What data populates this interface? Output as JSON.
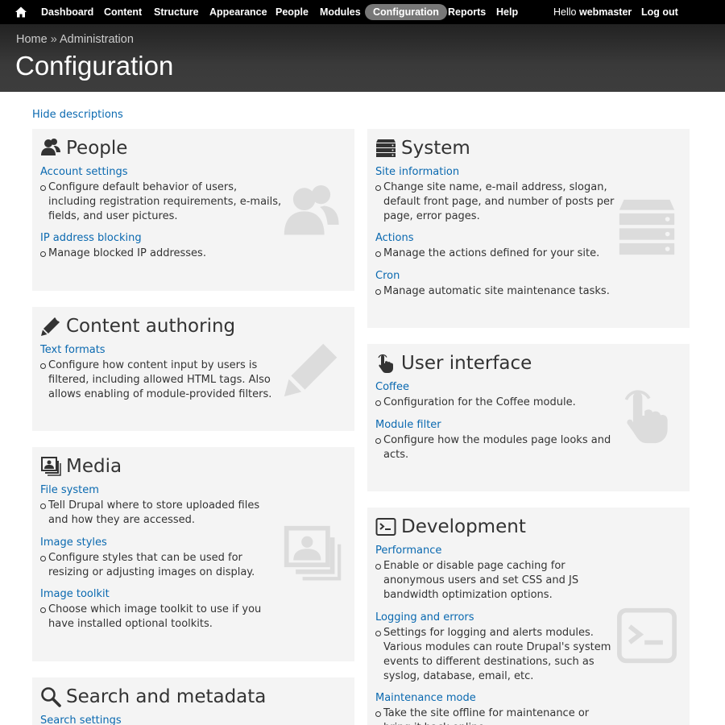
{
  "toolbar": {
    "items": [
      "Dashboard",
      "Content",
      "Structure",
      "Appearance",
      "People",
      "Modules",
      "Configuration",
      "Reports",
      "Help"
    ],
    "active": "Configuration",
    "hello_prefix": "Hello ",
    "username": "webmaster",
    "logout": "Log out",
    "home_icon": "home-icon"
  },
  "header": {
    "breadcrumb": [
      "Home",
      "Administration"
    ],
    "breadcrumb_separator": " » ",
    "title": "Configuration"
  },
  "hide_descriptions": "Hide descriptions",
  "panels": {
    "people": {
      "title": "People",
      "icon": "people-icon",
      "entries": [
        {
          "link": "Account settings",
          "desc": "Configure default behavior of users, including registration requirements, e-mails, fields, and user pictures."
        },
        {
          "link": "IP address blocking",
          "desc": "Manage blocked IP addresses."
        }
      ]
    },
    "content": {
      "title": "Content authoring",
      "icon": "pencil-icon",
      "entries": [
        {
          "link": "Text formats",
          "desc": "Configure how content input by users is filtered, including allowed HTML tags. Also allows enabling of module-provided filters."
        }
      ]
    },
    "media": {
      "title": "Media",
      "icon": "images-icon",
      "entries": [
        {
          "link": "File system",
          "desc": "Tell Drupal where to store uploaded files and how they are accessed."
        },
        {
          "link": "Image styles",
          "desc": "Configure styles that can be used for resizing or adjusting images on display."
        },
        {
          "link": "Image toolkit",
          "desc": "Choose which image toolkit to use if you have installed optional toolkits."
        }
      ]
    },
    "search": {
      "title": "Search and metadata",
      "icon": "search-icon",
      "entries": [
        {
          "link": "Search settings",
          "desc": ""
        }
      ]
    },
    "system": {
      "title": "System",
      "icon": "server-icon",
      "entries": [
        {
          "link": "Site information",
          "desc": "Change site name, e-mail address, slogan, default front page, and number of posts per page, error pages."
        },
        {
          "link": "Actions",
          "desc": "Manage the actions defined for your site."
        },
        {
          "link": "Cron",
          "desc": "Manage automatic site maintenance tasks."
        }
      ]
    },
    "ui": {
      "title": "User interface",
      "icon": "pointer-hand-icon",
      "entries": [
        {
          "link": "Coffee",
          "desc": "Configuration for the Coffee module."
        },
        {
          "link": "Module filter",
          "desc": "Configure how the modules page looks and acts."
        }
      ]
    },
    "dev": {
      "title": "Development",
      "icon": "terminal-icon",
      "entries": [
        {
          "link": "Performance",
          "desc": "Enable or disable page caching for anonymous users and set CSS and JS bandwidth optimization options."
        },
        {
          "link": "Logging and errors",
          "desc": "Settings for logging and alerts modules. Various modules can route Drupal's system events to different destinations, such as syslog, database, email, etc."
        },
        {
          "link": "Maintenance mode",
          "desc": "Take the site offline for maintenance or bring it back online."
        }
      ]
    }
  }
}
